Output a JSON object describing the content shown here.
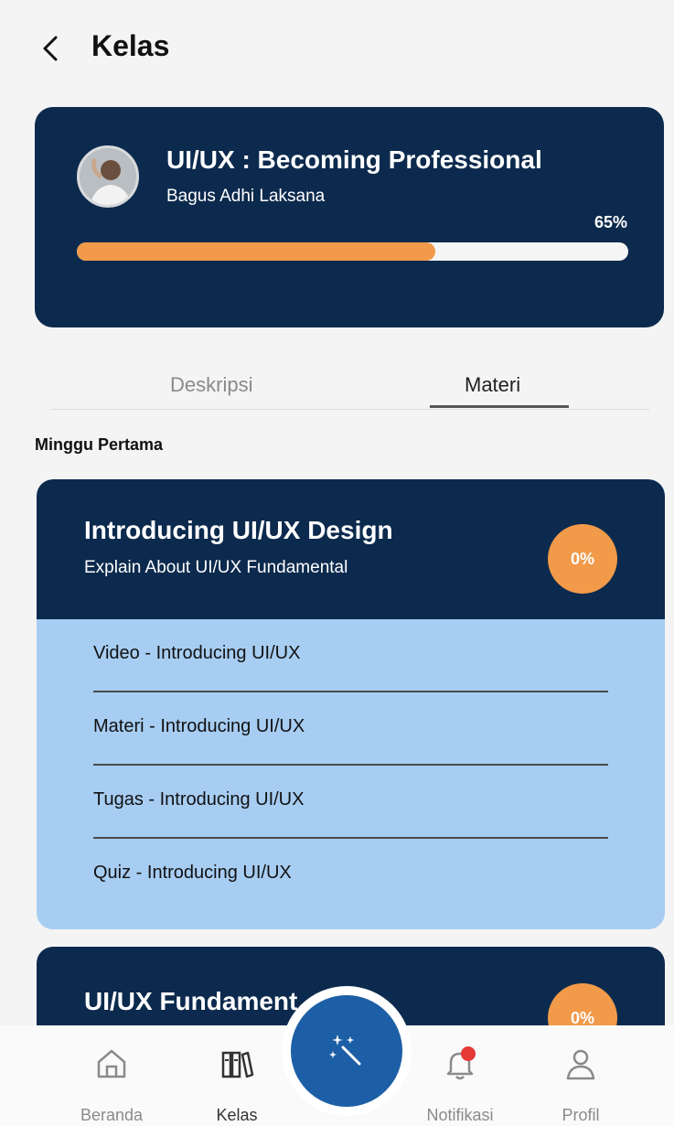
{
  "header": {
    "title": "Kelas"
  },
  "course": {
    "title": "UI/UX : Becoming Professional",
    "author": "Bagus Adhi Laksana",
    "progress_label": "65%",
    "progress_value": 0.65
  },
  "tabs": [
    {
      "label": "Deskripsi"
    },
    {
      "label": "Materi"
    }
  ],
  "week": {
    "title": "Minggu Pertama"
  },
  "modules": [
    {
      "title": "Introducing UI/UX Design",
      "subtitle": "Explain About UI/UX Fundamental",
      "percent": "0%",
      "lessons": [
        "Video - Introducing UI/UX",
        "Materi - Introducing UI/UX",
        "Tugas - Introducing UI/UX",
        "Quiz - Introducing UI/UX"
      ]
    },
    {
      "title": "UI/UX Fundament",
      "percent": "0%"
    }
  ],
  "nav": [
    {
      "label": "Beranda",
      "icon": "home-icon"
    },
    {
      "label": "Kelas",
      "icon": "library-icon"
    },
    {
      "label": "",
      "icon": "magic-wand-icon"
    },
    {
      "label": "Notifikasi",
      "icon": "bell-icon"
    },
    {
      "label": "Profil",
      "icon": "user-icon"
    }
  ],
  "colors": {
    "navy": "#0c2a4d",
    "accent_orange": "#f09a4a",
    "lesson_bg": "#a7cdf2",
    "fab_blue": "#1c5fa6",
    "notif_dot": "#e53935"
  }
}
